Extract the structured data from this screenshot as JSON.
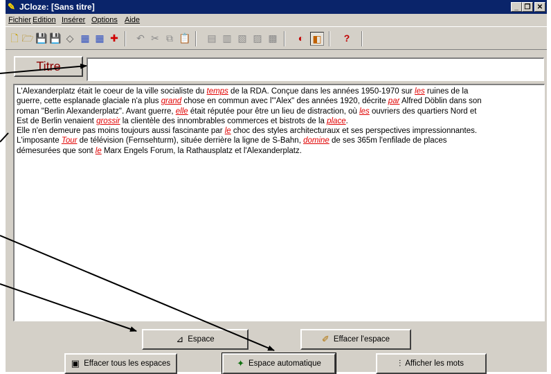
{
  "window": {
    "title": "JCloze: [Sans titre]"
  },
  "menu": [
    "Fichier",
    "Edition",
    "Insérer",
    "Options",
    "Aide"
  ],
  "toolbar": {
    "icons": [
      "new-file-icon",
      "open-folder-icon",
      "save-icon",
      "save-as-icon",
      "erase-icon",
      "web-export-icon",
      "web-export2-icon",
      "add-gap-icon",
      "undo-icon",
      "cut-icon",
      "copy-icon",
      "paste-icon",
      "tool1-icon",
      "tool2-icon",
      "tool3-icon",
      "tool4-icon",
      "tool5-icon",
      "view1-icon",
      "view2-icon",
      "help-icon"
    ]
  },
  "titre": {
    "label": "Titre",
    "value": ""
  },
  "document": {
    "lines": [
      [
        {
          "t": "L'Alexanderplatz était le coeur de la ville socialiste du "
        },
        {
          "t": "temps",
          "gap": true
        },
        {
          "t": " de la RDA. Conçue dans les années 1950-1970 sur "
        },
        {
          "t": "les",
          "gap": true
        },
        {
          "t": " ruines de la"
        }
      ],
      [
        {
          "t": "guerre, cette esplanade glaciale n'a plus "
        },
        {
          "t": "grand",
          "gap": true
        },
        {
          "t": " chose en commun avec l'\"Alex\" des années 1920, décrite "
        },
        {
          "t": "par",
          "gap": true
        },
        {
          "t": " Alfred Döblin dans son"
        }
      ],
      [
        {
          "t": "roman \"Berlin Alexanderplatz\". Avant guerre, "
        },
        {
          "t": "elle",
          "gap": true
        },
        {
          "t": " était réputée pour être un lieu de distraction, où "
        },
        {
          "t": "les",
          "gap": true
        },
        {
          "t": " ouvriers des quartiers Nord et"
        }
      ],
      [
        {
          "t": "Est de Berlin venaient "
        },
        {
          "t": "grossir",
          "gap": true
        },
        {
          "t": " la clientèle des innombrables commerces et bistrots de la "
        },
        {
          "t": "place",
          "gap": true
        },
        {
          "t": "."
        }
      ],
      [
        {
          "t": "Elle n'en demeure pas moins toujours aussi fascinante par "
        },
        {
          "t": "le",
          "gap": true
        },
        {
          "t": " choc des styles architecturaux et ses perspectives impressionnantes."
        }
      ],
      [
        {
          "t": "L'imposante "
        },
        {
          "t": "Tour",
          "gap": true
        },
        {
          "t": " de télévision (Fernsehturm), située derrière la ligne de S-Bahn, "
        },
        {
          "t": "domine",
          "gap": true
        },
        {
          "t": " de ses 365m l'enfilade de places"
        }
      ],
      [
        {
          "t": "démesurées que sont "
        },
        {
          "t": "le",
          "gap": true
        },
        {
          "t": " Marx Engels Forum, la Rathausplatz et l'Alexanderplatz."
        }
      ]
    ]
  },
  "buttons": {
    "espace": "Espace",
    "effacer_espace": "Effacer l'espace",
    "effacer_tous": "Effacer tous les espaces",
    "espace_auto": "Espace automatique",
    "afficher_mots": "Afficher les mots"
  },
  "colors": {
    "titlebar": "#0a246a",
    "gap": "#e00000",
    "label": "#8b0000"
  }
}
